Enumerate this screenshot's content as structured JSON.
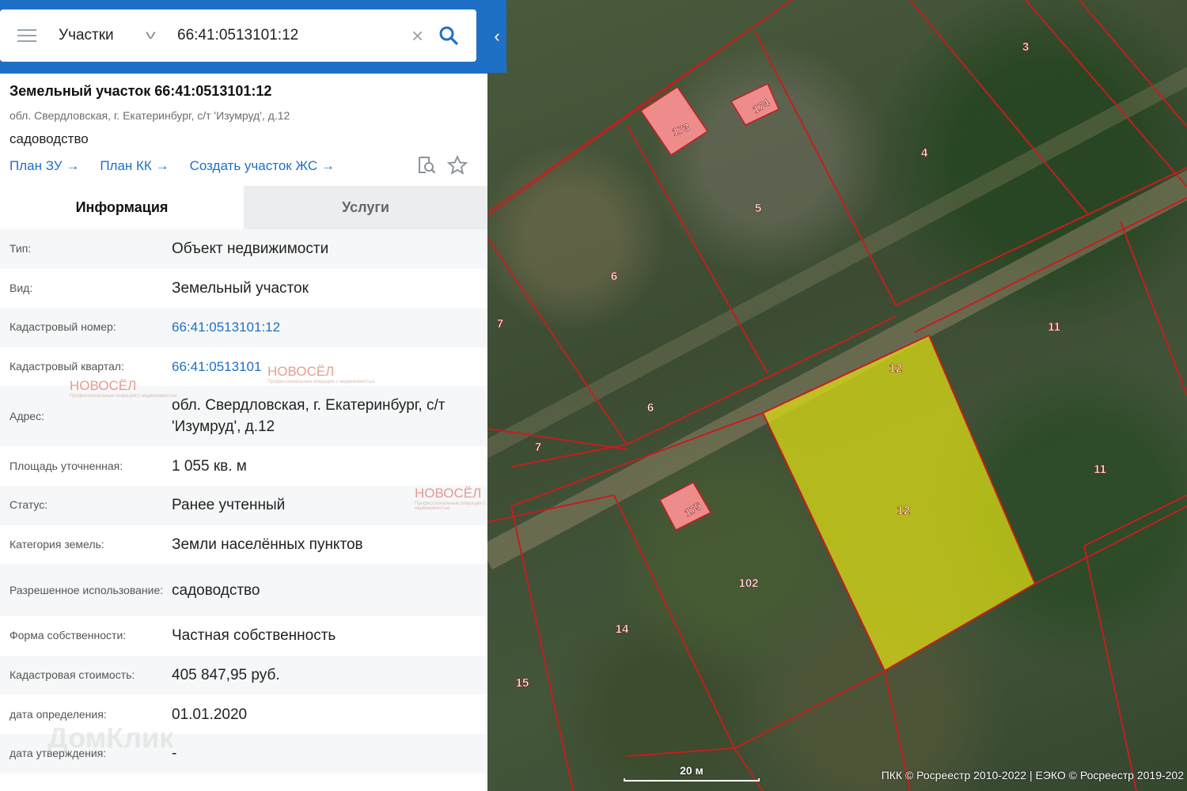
{
  "search": {
    "category": "Участки",
    "query": "66:41:0513101:12"
  },
  "object": {
    "title": "Земельный участок 66:41:0513101:12",
    "address": "обл. Свердловская, г. Екатеринбург, с/т 'Изумруд', д.12",
    "use": "садоводство",
    "links": [
      "План ЗУ",
      "План КК",
      "Создать участок ЖС"
    ]
  },
  "tabs": [
    "Информация",
    "Услуги"
  ],
  "info_rows": [
    {
      "label": "Тип:",
      "value": "Объект недвижимости"
    },
    {
      "label": "Вид:",
      "value": "Земельный участок"
    },
    {
      "label": "Кадастровый номер:",
      "value": "66:41:0513101:12"
    },
    {
      "label": "Кадастровый квартал:",
      "value": "66:41:0513101"
    },
    {
      "label": "Адрес:",
      "value": "обл. Свердловская, г. Екатеринбург, с/т 'Изумруд', д.12"
    },
    {
      "label": "Площадь уточненная:",
      "value": "1 055 кв. м"
    },
    {
      "label": "Статус:",
      "value": "Ранее учтенный"
    },
    {
      "label": "Категория земель:",
      "value": "Земли населённых пунктов"
    },
    {
      "label": "Разрешенное использование:",
      "value": "садоводство"
    },
    {
      "label": "Форма собственности:",
      "value": "Частная собственность"
    },
    {
      "label": "Кадастровая стоимость:",
      "value": "405 847,95 руб."
    },
    {
      "label": "дата определения:",
      "value": "01.01.2020"
    },
    {
      "label": "дата утверждения:",
      "value": "-"
    },
    {
      "label": "",
      "value": ""
    }
  ],
  "watermarks": {
    "brand": "НОВОСЁЛ",
    "tagline": "Профессиональные операции с недвижимостью",
    "domclick": "ДомКлик"
  },
  "map": {
    "parcel_labels": [
      "3",
      "4",
      "5",
      "6",
      "7",
      "11",
      "12",
      "14",
      "15",
      "102",
      "173",
      "174",
      "175"
    ],
    "scale_label": "20 м",
    "attribution": "ПКК © Росреестр 2010-2022 | ЕЭКО © Росреестр 2019-202",
    "colors": {
      "boundary": "#c41e1e",
      "selected_fill": "#e6e612",
      "building_fill": "#ee8c8c",
      "accent": "#1e6fc6"
    }
  }
}
